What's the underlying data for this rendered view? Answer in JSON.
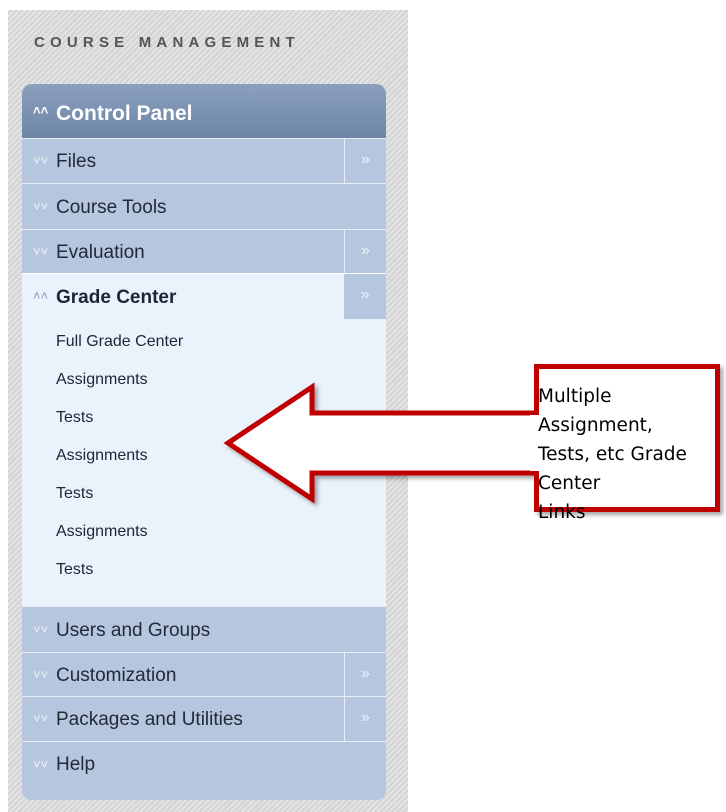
{
  "section_title": "COURSE MANAGEMENT",
  "control_panel": {
    "title": "Control Panel",
    "collapse_icon": "double-chevron-up-icon",
    "items": [
      {
        "label": "Files",
        "expanded": false,
        "has_flyout": true
      },
      {
        "label": "Course Tools",
        "expanded": false,
        "has_flyout": false
      },
      {
        "label": "Evaluation",
        "expanded": false,
        "has_flyout": true
      },
      {
        "label": "Grade Center",
        "expanded": true,
        "has_flyout": true
      },
      {
        "label": "Users and Groups",
        "expanded": false,
        "has_flyout": false
      },
      {
        "label": "Customization",
        "expanded": false,
        "has_flyout": true
      },
      {
        "label": "Packages and Utilities",
        "expanded": false,
        "has_flyout": true
      },
      {
        "label": "Help",
        "expanded": false,
        "has_flyout": false
      }
    ],
    "grade_center_links": [
      "Full Grade Center",
      "Assignments",
      "Tests",
      "Assignments",
      "Tests",
      "Assignments",
      "Tests"
    ]
  },
  "callout": {
    "text_lines": [
      "Multiple Assignment,",
      "Tests, etc Grade Center",
      "Links"
    ],
    "border_color": "#c00000"
  },
  "colors": {
    "header": "#7a8fb0",
    "menu_row": "#b6c6de",
    "expanded_bg": "#eaf2fc"
  }
}
